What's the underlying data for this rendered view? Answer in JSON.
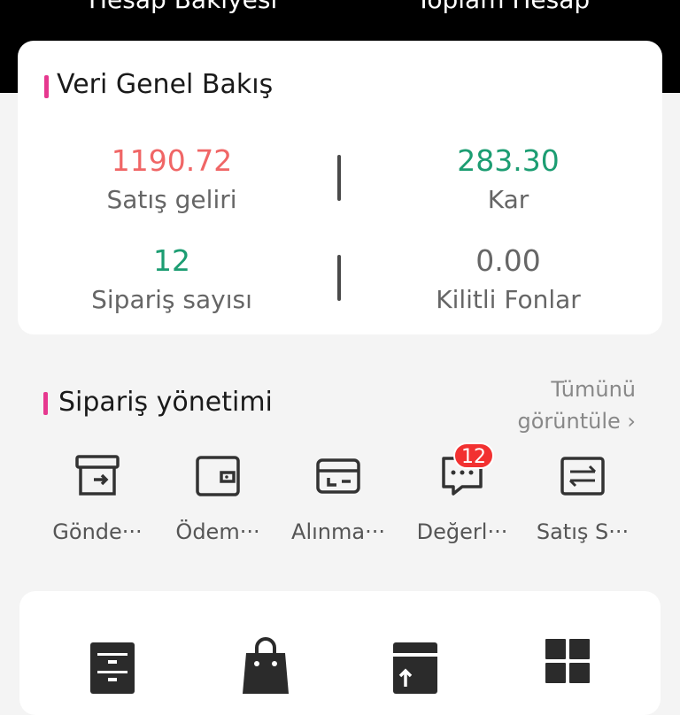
{
  "header": {
    "left_label": "Hesap Bakiyesi",
    "right_label": "Toplam Hesap"
  },
  "overview": {
    "title": "Veri Genel Bakış",
    "stats": [
      {
        "value": "1190.72",
        "label": "Satış geliri",
        "color": "#f06666"
      },
      {
        "value": "283.30",
        "label": "Kar",
        "color": "#1c9d72"
      },
      {
        "value": "12",
        "label": "Sipariş sayısı",
        "color": "#1c9d72"
      },
      {
        "value": "0.00",
        "label": "Kilitli Fonlar",
        "color": "#666666"
      }
    ]
  },
  "orders": {
    "title": "Sipariş yönetimi",
    "view_all_line1": "Tümünü",
    "view_all_line2": "görüntüle",
    "items": [
      {
        "label": "Gönde···",
        "icon": "shipping-box-icon"
      },
      {
        "label": "Ödem···",
        "icon": "wallet-icon"
      },
      {
        "label": "Alınma···",
        "icon": "receive-card-icon"
      },
      {
        "label": "Değerl···",
        "icon": "review-message-icon",
        "badge": "12"
      },
      {
        "label": "Satış S···",
        "icon": "exchange-icon"
      }
    ]
  },
  "tools": {
    "icons": [
      "cabinet-icon",
      "shopping-bag-icon",
      "upload-window-icon",
      "grid-icon"
    ]
  },
  "colors": {
    "accent": "#e6388f",
    "badge": "#f23131",
    "positive": "#1c9d72",
    "sales": "#f06666"
  }
}
